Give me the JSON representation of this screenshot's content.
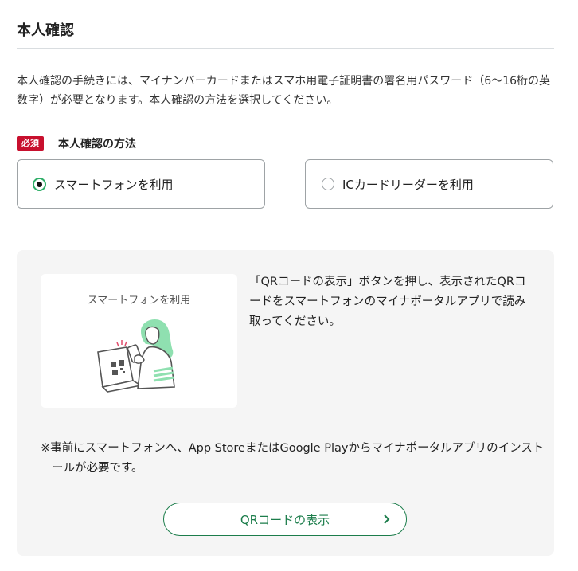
{
  "page": {
    "title": "本人確認",
    "intro": "本人確認の手続きには、マイナンバーカードまたはスマホ用電子証明書の署名用パスワード（6〜16桁の英数字）が必要となります。本人確認の方法を選択してください。"
  },
  "method_field": {
    "required_badge": "必須",
    "label": "本人確認の方法",
    "options": [
      {
        "label": "スマートフォンを利用",
        "selected": true
      },
      {
        "label": "ICカードリーダーを利用",
        "selected": false
      }
    ]
  },
  "panel": {
    "illustration_caption": "スマートフォンを利用",
    "instruction": "「QRコードの表示」ボタンを押し、表示されたQRコードをスマートフォンのマイナポータルアプリで読み取ってください。",
    "note": "※事前にスマートフォンへ、App StoreまたはGoogle Playからマイナポータルアプリのインストールが必要です。",
    "qr_button_label": "QRコードの表示"
  },
  "colors": {
    "accent_green": "#1c7d4b",
    "radio_green": "#2fae68",
    "required_red": "#c8102e",
    "panel_bg": "#f5f5f5"
  },
  "icons": [
    "radio-checked-icon",
    "radio-unchecked-icon",
    "chevron-right-icon",
    "smartphone-qr-illustration"
  ]
}
